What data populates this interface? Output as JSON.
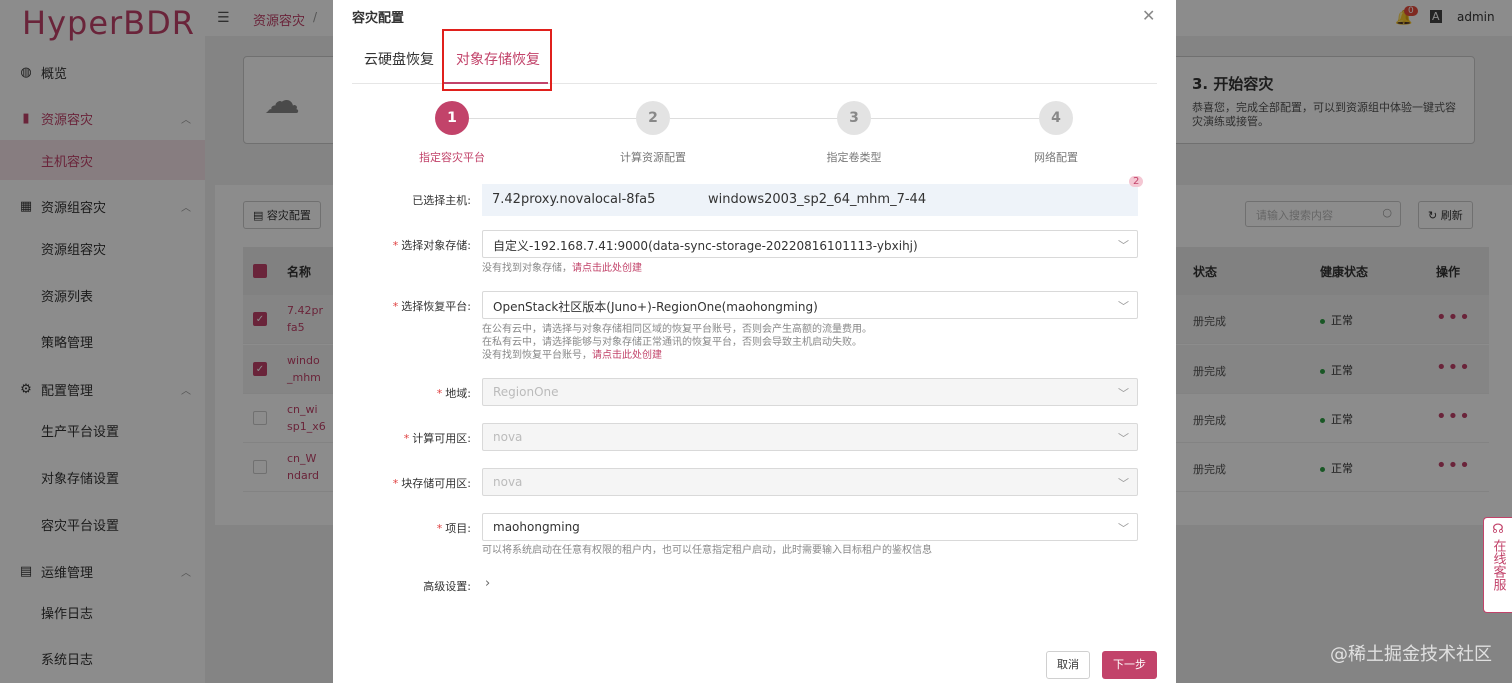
{
  "app": {
    "logo": "HyperBDR",
    "breadcrumb": "资源容灾",
    "breadcrumb_sep": "/",
    "notif_count": "0",
    "lang_label": "A",
    "user": "admin"
  },
  "sidebar": {
    "items": [
      {
        "label": "概览",
        "icon": "dashboard-icon"
      },
      {
        "label": "资源容灾",
        "icon": "server-icon"
      },
      {
        "label": "主机容灾"
      },
      {
        "label": "资源组容灾",
        "icon": "group-icon"
      },
      {
        "label": "资源组容灾"
      },
      {
        "label": "资源列表"
      },
      {
        "label": "策略管理"
      },
      {
        "label": "配置管理",
        "icon": "gear-icon"
      },
      {
        "label": "生产平台设置"
      },
      {
        "label": "对象存储设置"
      },
      {
        "label": "容灾平台设置"
      },
      {
        "label": "运维管理",
        "icon": "doc-icon"
      },
      {
        "label": "操作日志"
      },
      {
        "label": "系统日志"
      }
    ]
  },
  "background": {
    "step3_title": "3. 开始容灾",
    "step3_desc": "恭喜您，完成全部配置，可以到资源组中体验一键式容灾演练或接管。",
    "dr_config_button": "容灾配置",
    "search_placeholder": "请输入搜索内容",
    "refresh_button": "刷新",
    "columns": {
      "name": "名称",
      "status": "状态",
      "health": "健康状态",
      "ops": "操作"
    },
    "rows": [
      {
        "name1": "7.42pr",
        "name2": "fa5",
        "status": "册完成",
        "health": "正常",
        "checked": true
      },
      {
        "name1": "windo",
        "name2": "_mhm",
        "status": "册完成",
        "health": "正常",
        "checked": true
      },
      {
        "name1": "cn_wi",
        "name2": "sp1_x6",
        "status": "册完成",
        "health": "正常",
        "checked": false
      },
      {
        "name1": "cn_W",
        "name2": "ndard",
        "status": "册完成",
        "health": "正常",
        "checked": false
      }
    ]
  },
  "dialog": {
    "title": "容灾配置",
    "tabs": [
      {
        "label": "云硬盘恢复",
        "active": false
      },
      {
        "label": "对象存储恢复",
        "active": true
      }
    ],
    "steps": [
      {
        "num": "1",
        "label": "指定容灾平台",
        "active": true
      },
      {
        "num": "2",
        "label": "计算资源配置",
        "active": false
      },
      {
        "num": "3",
        "label": "指定卷类型",
        "active": false
      },
      {
        "num": "4",
        "label": "网络配置",
        "active": false
      }
    ],
    "selected_hosts_label": "已选择主机:",
    "selected_hosts": [
      "7.42proxy.novalocal-8fa5",
      "windows2003_sp2_64_mhm_7-44"
    ],
    "selected_count": "2",
    "object_storage": {
      "label": "选择对象存储:",
      "value": "自定义-192.168.7.41:9000(data-sync-storage-20220816101113-ybxihj)",
      "hint": "没有找到对象存储，",
      "hint_link": "请点击此处创建"
    },
    "recovery_platform": {
      "label": "选择恢复平台:",
      "value": "OpenStack社区版本(Juno+)-RegionOne(maohongming)",
      "hint1": "在公有云中，请选择与对象存储相同区域的恢复平台账号，否则会产生高额的流量费用。",
      "hint2": "在私有云中，请选择能够与对象存储正常通讯的恢复平台，否则会导致主机启动失败。",
      "hint3": "没有找到恢复平台账号，",
      "hint_link": "请点击此处创建"
    },
    "region": {
      "label": "地域:",
      "value": "RegionOne"
    },
    "compute_zone": {
      "label": "计算可用区:",
      "value": "nova"
    },
    "storage_zone": {
      "label": "块存储可用区:",
      "value": "nova"
    },
    "project": {
      "label": "项目:",
      "value": "maohongming",
      "hint": "可以将系统启动在任意有权限的租户内，也可以任意指定租户启动，此时需要输入目标租户的鉴权信息"
    },
    "advanced_label": "高级设置:",
    "cancel_button": "取消",
    "next_button": "下一步"
  },
  "service_tab": "在线客服",
  "watermark": "@稀土掘金技术社区",
  "colors": {
    "accent": "#c2436a",
    "highlight_box": "#e0201c",
    "health_ok": "#2e9e44"
  }
}
